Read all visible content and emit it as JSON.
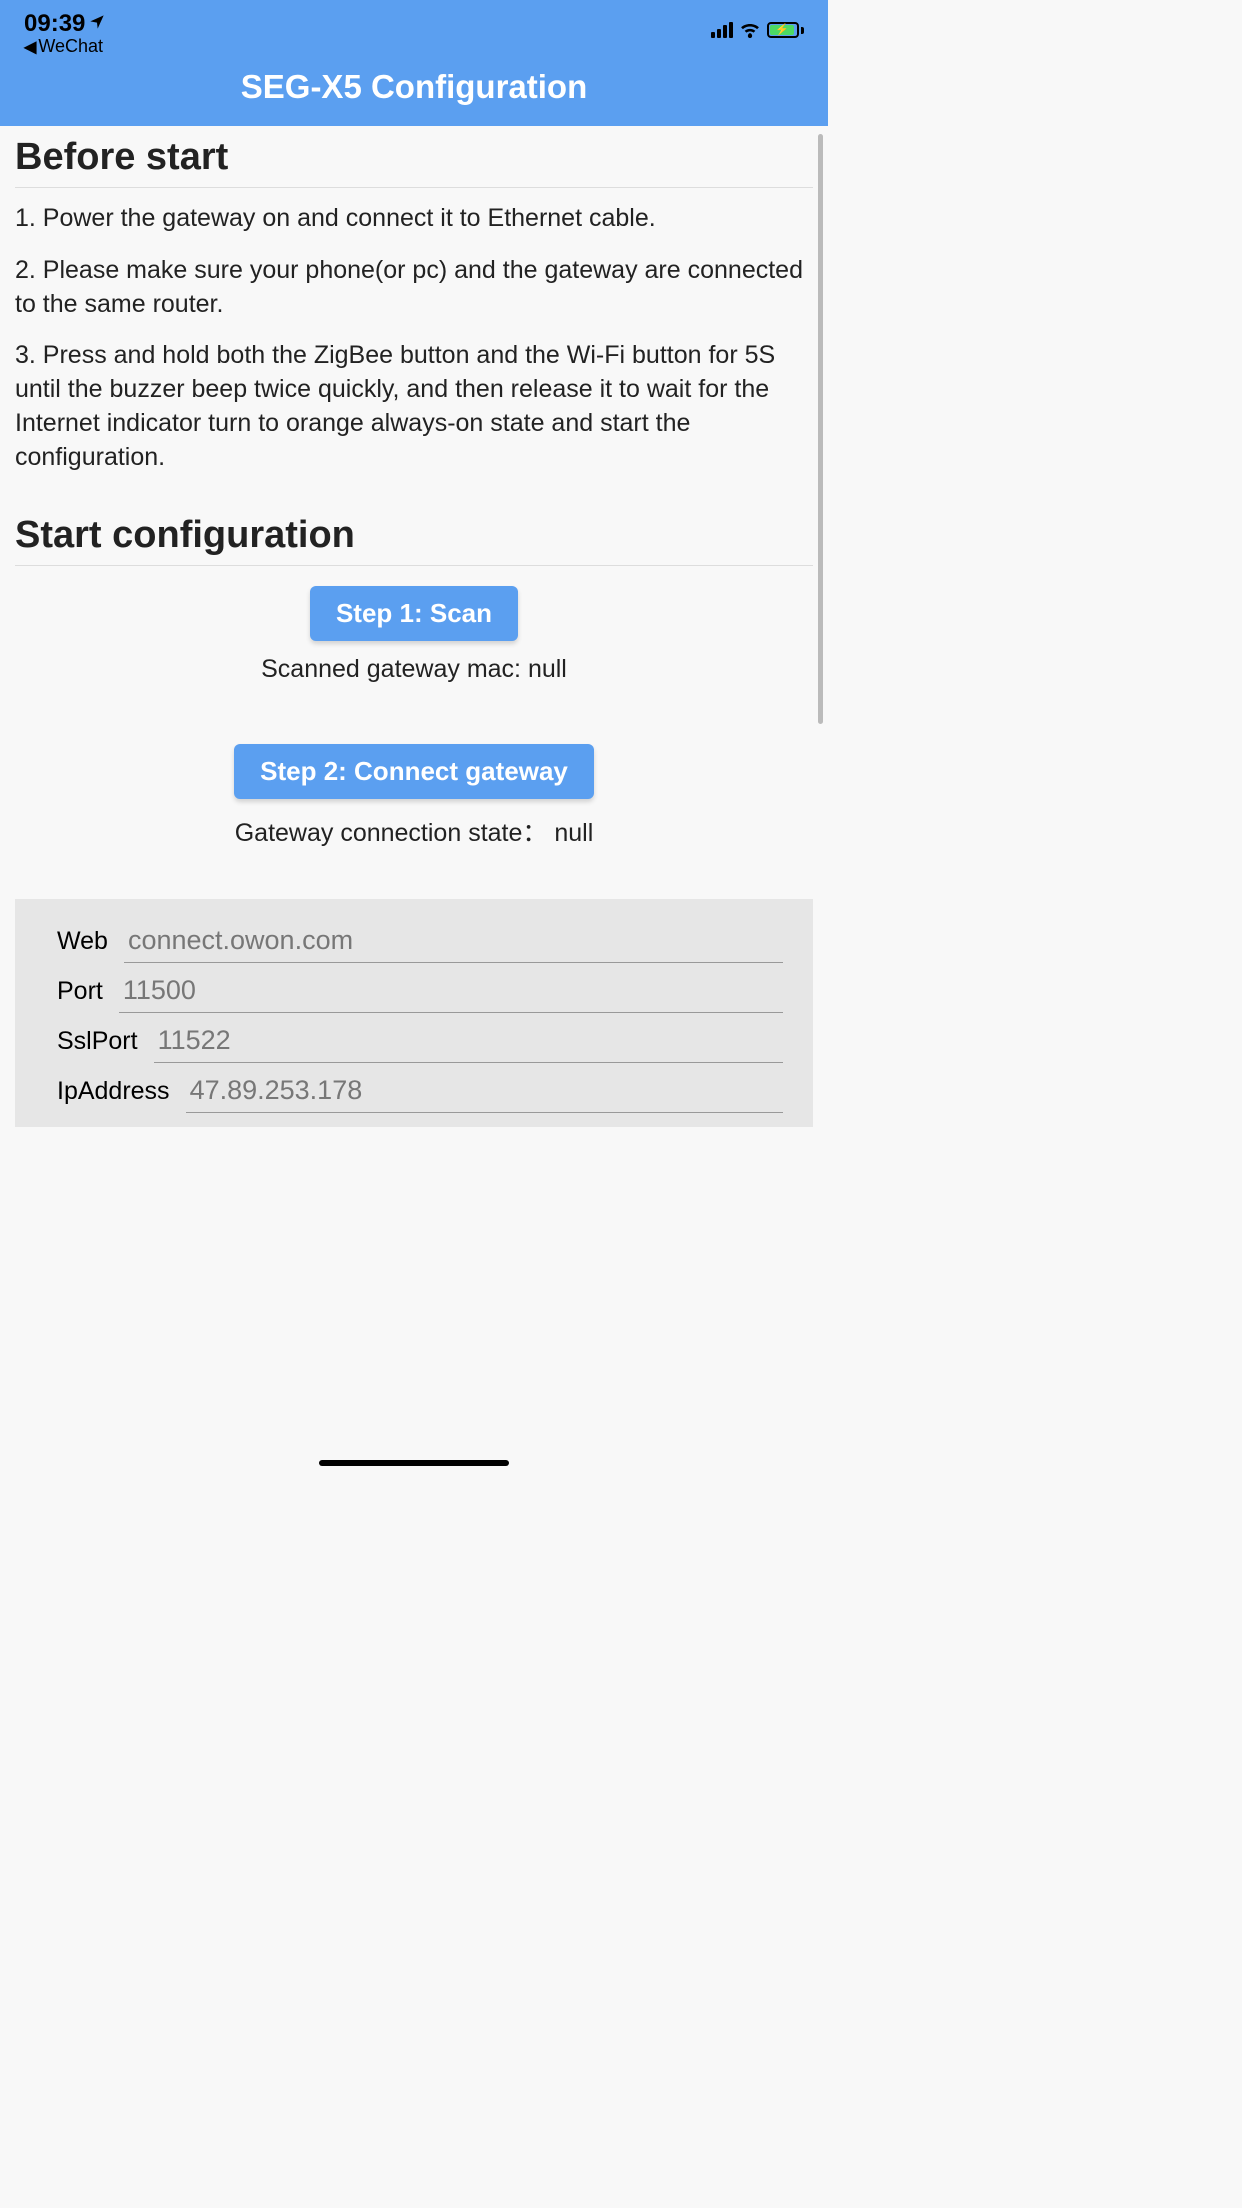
{
  "statusBar": {
    "time": "09:39",
    "backLabel": "WeChat"
  },
  "nav": {
    "title": "SEG-X5 Configuration"
  },
  "beforeStart": {
    "heading": "Before start",
    "step1": "1. Power the gateway on and connect it to Ethernet cable.",
    "step2": "2. Please make sure your phone(or pc) and the gateway are connected to the same router.",
    "step3": "3. Press and hold both the ZigBee button and the Wi-Fi button for 5S until the buzzer beep twice quickly, and then release it to wait for the Internet indicator turn to orange always-on state and start the configuration."
  },
  "startConfig": {
    "heading": "Start configuration",
    "step1Button": "Step 1: Scan",
    "scannedStatus": "Scanned gateway mac: null",
    "step2Button": "Step 2: Connect gateway",
    "connectionStatus": "Gateway connection state： null"
  },
  "configFields": {
    "webLabel": "Web",
    "webValue": "connect.owon.com",
    "portLabel": "Port",
    "portValue": "11500",
    "sslPortLabel": "SslPort",
    "sslPortValue": "11522",
    "ipAddressLabel": "IpAddress",
    "ipAddressValue": "47.89.253.178"
  }
}
